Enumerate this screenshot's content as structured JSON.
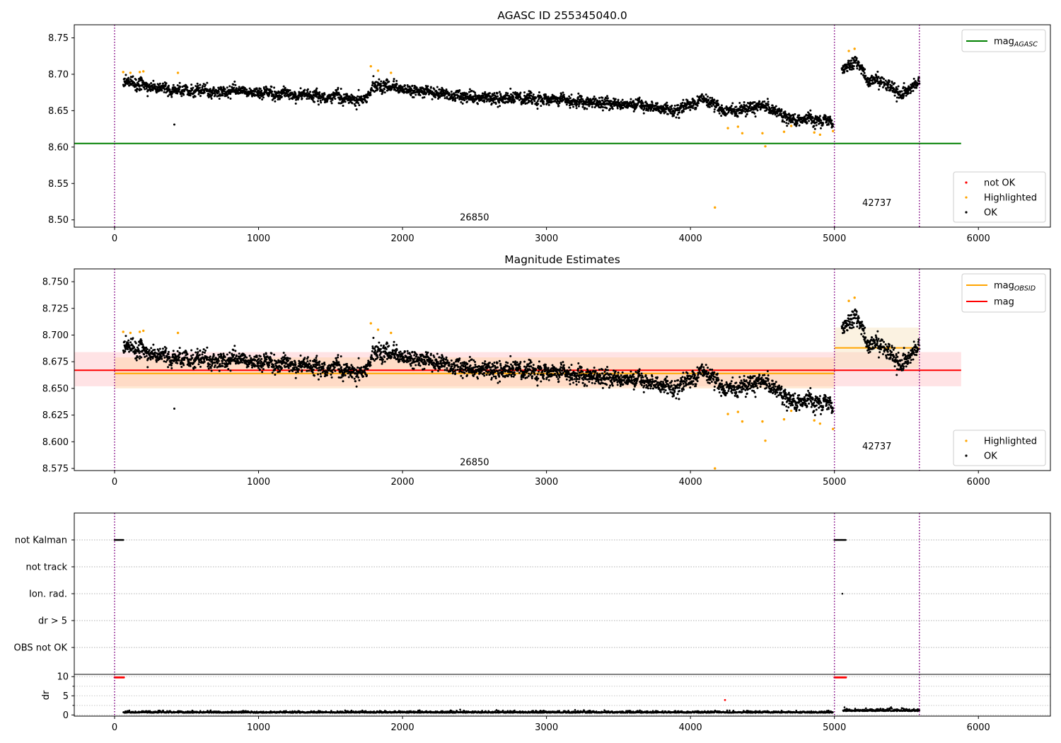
{
  "chart_data": [
    {
      "type": "scatter",
      "title": "AGASC ID 255345040.0",
      "xlim": [
        -280,
        6500
      ],
      "ylim": [
        8.49,
        8.768
      ],
      "x_ticks": [
        0,
        1000,
        2000,
        3000,
        4000,
        5000,
        6000
      ],
      "y_ticks": [
        8.5,
        8.55,
        8.6,
        8.65,
        8.7,
        8.75
      ],
      "y_tick_labels": [
        "8.50",
        "8.55",
        "8.60",
        "8.65",
        "8.70",
        "8.75"
      ],
      "vlines": [
        0,
        5000,
        5590
      ],
      "vline_color": "#800080",
      "annotations": [
        {
          "text": "26850",
          "x": 2500,
          "y": 8.499
        },
        {
          "text": "42737",
          "x": 5295,
          "y": 8.519
        }
      ],
      "hlines": [
        {
          "name_main": "mag",
          "name_sub": "AGASC",
          "y": 8.605,
          "x0": -280,
          "x1": 5880,
          "color": "#008000"
        }
      ],
      "line_legend": {
        "location": "upper right",
        "entries": [
          {
            "label_main": "mag",
            "label_sub": "AGASC",
            "color": "#008000"
          }
        ]
      },
      "point_legend": {
        "location": "lower right",
        "entries": [
          {
            "label": "not OK",
            "color": "#ff0000"
          },
          {
            "label": "Highlighted",
            "color": "#ffa500"
          },
          {
            "label": "OK",
            "color": "#000000"
          }
        ]
      },
      "segments": [
        {
          "x_range": [
            60,
            4990
          ],
          "trend": [
            [
              60,
              8.69
            ],
            [
              400,
              8.677
            ],
            [
              1000,
              8.675
            ],
            [
              1750,
              8.665
            ],
            [
              1800,
              8.685
            ],
            [
              2500,
              8.668
            ],
            [
              3000,
              8.665
            ],
            [
              3500,
              8.66
            ],
            [
              3900,
              8.652
            ],
            [
              4100,
              8.665
            ],
            [
              4250,
              8.648
            ],
            [
              4500,
              8.66
            ],
            [
              4700,
              8.638
            ],
            [
              5000,
              8.635
            ]
          ],
          "noise": 0.008
        },
        {
          "x_range": [
            5050,
            5590
          ],
          "trend": [
            [
              5050,
              8.705
            ],
            [
              5150,
              8.718
            ],
            [
              5230,
              8.69
            ],
            [
              5300,
              8.695
            ],
            [
              5450,
              8.672
            ],
            [
              5590,
              8.69
            ]
          ],
          "noise": 0.008
        }
      ],
      "outliers_highlighted": [
        [
          60,
          8.703
        ],
        [
          110,
          8.702
        ],
        [
          175,
          8.703
        ],
        [
          200,
          8.704
        ],
        [
          440,
          8.702
        ],
        [
          1780,
          8.711
        ],
        [
          1830,
          8.705
        ],
        [
          1920,
          8.702
        ],
        [
          4170,
          8.517
        ],
        [
          4260,
          8.626
        ],
        [
          4330,
          8.628
        ],
        [
          4360,
          8.619
        ],
        [
          4500,
          8.619
        ],
        [
          4520,
          8.601
        ],
        [
          4650,
          8.621
        ],
        [
          4700,
          8.629
        ],
        [
          4860,
          8.62
        ],
        [
          4900,
          8.617
        ],
        [
          4990,
          8.622
        ],
        [
          5100,
          8.732
        ],
        [
          5140,
          8.735
        ]
      ],
      "outliers_ok": [
        [
          415,
          8.631
        ]
      ]
    },
    {
      "type": "scatter",
      "title": "Magnitude Estimates",
      "xlim": [
        -280,
        6500
      ],
      "ylim": [
        8.573,
        8.762
      ],
      "x_ticks": [
        0,
        1000,
        2000,
        3000,
        4000,
        5000,
        6000
      ],
      "y_ticks": [
        8.575,
        8.6,
        8.625,
        8.65,
        8.675,
        8.7,
        8.725,
        8.75
      ],
      "y_tick_labels": [
        "8.575",
        "8.600",
        "8.625",
        "8.650",
        "8.675",
        "8.700",
        "8.725",
        "8.750"
      ],
      "vlines": [
        0,
        5000,
        5590
      ],
      "vline_color": "#800080",
      "annotations": [
        {
          "text": "26850",
          "x": 2500,
          "y": 8.578
        },
        {
          "text": "42737",
          "x": 5295,
          "y": 8.593
        }
      ],
      "bands": [
        {
          "x0": -280,
          "x1": 5880,
          "y0": 8.652,
          "y1": 8.684,
          "color": "#ff9aa2",
          "opacity": 0.28
        },
        {
          "x0": 0,
          "x1": 5000,
          "y0": 8.65,
          "y1": 8.679,
          "color": "#ffd0a0",
          "opacity": 0.45
        },
        {
          "x0": 5000,
          "x1": 5590,
          "y0": 8.669,
          "y1": 8.707,
          "color": "#f5deb3",
          "opacity": 0.4
        }
      ],
      "hlines": [
        {
          "y": 8.667,
          "x0": -280,
          "x1": 5880,
          "color": "#ff0000"
        },
        {
          "y": 8.664,
          "x0": 0,
          "x1": 5000,
          "color": "#ffa500"
        },
        {
          "y": 8.688,
          "x0": 5000,
          "x1": 5590,
          "color": "#ffa500"
        }
      ],
      "line_legend": {
        "location": "upper right",
        "entries": [
          {
            "label_main": "mag",
            "label_sub": "OBSID",
            "color": "#ffa500"
          },
          {
            "label_main": "mag",
            "label_sub": "",
            "color": "#ff0000"
          }
        ]
      },
      "point_legend": {
        "location": "lower right",
        "entries": [
          {
            "label": "Highlighted",
            "color": "#ffa500"
          },
          {
            "label": "OK",
            "color": "#000000"
          }
        ]
      },
      "segments": [
        {
          "x_range": [
            60,
            4990
          ],
          "trend": [
            [
              60,
              8.69
            ],
            [
              400,
              8.677
            ],
            [
              1000,
              8.675
            ],
            [
              1750,
              8.665
            ],
            [
              1800,
              8.685
            ],
            [
              2500,
              8.668
            ],
            [
              3000,
              8.665
            ],
            [
              3500,
              8.66
            ],
            [
              3900,
              8.652
            ],
            [
              4100,
              8.665
            ],
            [
              4250,
              8.648
            ],
            [
              4500,
              8.66
            ],
            [
              4700,
              8.638
            ],
            [
              5000,
              8.635
            ]
          ],
          "noise": 0.008
        },
        {
          "x_range": [
            5050,
            5590
          ],
          "trend": [
            [
              5050,
              8.705
            ],
            [
              5150,
              8.718
            ],
            [
              5230,
              8.69
            ],
            [
              5300,
              8.695
            ],
            [
              5450,
              8.672
            ],
            [
              5590,
              8.69
            ]
          ],
          "noise": 0.008
        }
      ],
      "outliers_highlighted": [
        [
          60,
          8.703
        ],
        [
          110,
          8.702
        ],
        [
          175,
          8.703
        ],
        [
          200,
          8.704
        ],
        [
          440,
          8.702
        ],
        [
          1780,
          8.711
        ],
        [
          1830,
          8.705
        ],
        [
          1920,
          8.702
        ],
        [
          4170,
          8.575
        ],
        [
          4260,
          8.626
        ],
        [
          4330,
          8.628
        ],
        [
          4360,
          8.619
        ],
        [
          4500,
          8.619
        ],
        [
          4520,
          8.601
        ],
        [
          4650,
          8.621
        ],
        [
          4700,
          8.629
        ],
        [
          4860,
          8.62
        ],
        [
          4900,
          8.617
        ],
        [
          4990,
          8.612
        ],
        [
          5100,
          8.732
        ],
        [
          5140,
          8.735
        ]
      ],
      "outliers_ok": [
        [
          415,
          8.631
        ]
      ]
    },
    {
      "type": "scatter",
      "title": "",
      "xlim": [
        -280,
        6500
      ],
      "flags": [
        "not Kalman",
        "not track",
        "Ion. rad.",
        "dr > 5",
        "OBS not OK"
      ],
      "flag_points": [
        {
          "flag": "not Kalman",
          "x_range": [
            0,
            65
          ],
          "color": "#000000"
        },
        {
          "flag": "not Kalman",
          "x_range": [
            5000,
            5080
          ],
          "color": "#000000"
        },
        {
          "flag": "Ion. rad.",
          "x_range": [
            5055,
            5055
          ],
          "color": "#000000"
        }
      ],
      "vlines": [
        0,
        5000,
        5590
      ],
      "vline_color": "#800080"
    },
    {
      "type": "scatter",
      "title": "",
      "ylabel": "dr",
      "xlim": [
        -280,
        6500
      ],
      "ylim": [
        -0.3,
        10.6
      ],
      "x_ticks": [
        0,
        1000,
        2000,
        3000,
        4000,
        5000,
        6000
      ],
      "y_ticks": [
        0,
        5,
        10
      ],
      "vlines": [
        0,
        5000,
        5590
      ],
      "vline_color": "#800080",
      "red_points": [
        {
          "x_range": [
            0,
            65
          ],
          "y": 9.8
        },
        {
          "x_range": [
            5000,
            5080
          ],
          "y": 9.8
        },
        {
          "x_range": [
            4240,
            4240
          ],
          "y": 3.9
        }
      ],
      "segments": [
        {
          "x_range": [
            60,
            4990
          ],
          "base": 0.55,
          "noise": 0.25
        },
        {
          "x_range": [
            5060,
            5590
          ],
          "base": 1.0,
          "noise": 0.3
        }
      ]
    }
  ]
}
